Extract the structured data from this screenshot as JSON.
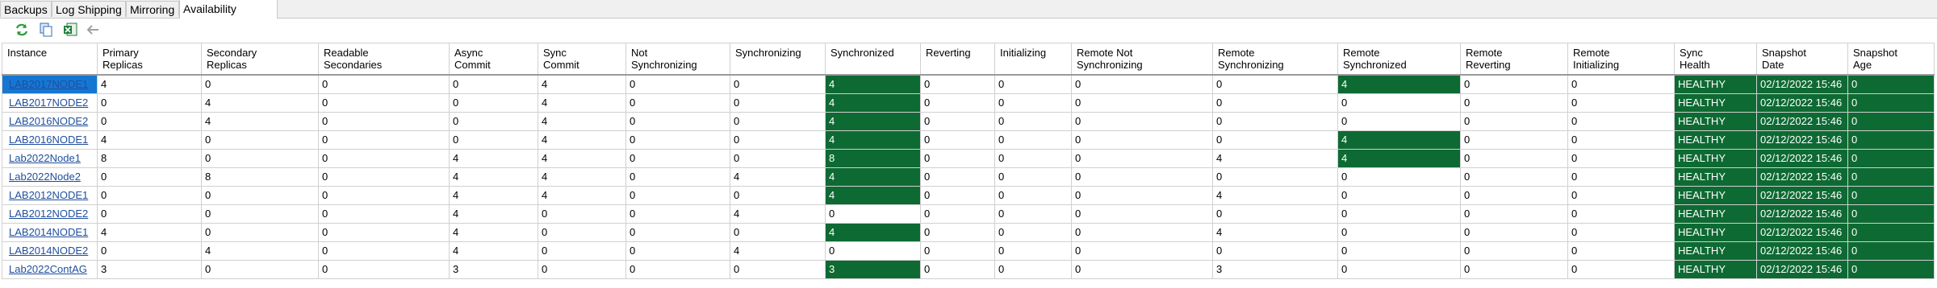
{
  "tabs": [
    {
      "label": "Backups",
      "active": false
    },
    {
      "label": "Log Shipping",
      "active": false
    },
    {
      "label": "Mirroring",
      "active": false
    },
    {
      "label": "Availability Groups",
      "active": true
    }
  ],
  "toolbar": [
    {
      "icon": "refresh-icon"
    },
    {
      "icon": "copy-icon"
    },
    {
      "icon": "export-excel-icon"
    },
    {
      "icon": "back-arrow-icon"
    }
  ],
  "colors": {
    "accent_green": "#0e6a33",
    "selection_blue": "#1677d3",
    "link": "#1f4e9e"
  },
  "grid": {
    "columns": [
      "Instance",
      "Primary\nReplicas",
      "Secondary\nReplicas",
      "Readable\nSecondaries",
      "Async\nCommit",
      "Sync\nCommit",
      "Not\nSynchronizing",
      "Synchronizing",
      "Synchronized",
      "Reverting",
      "Initializing",
      "Remote Not\nSynchronizing",
      "Remote\nSynchronizing",
      "Remote\nSynchronized",
      "Remote\nReverting",
      "Remote\nInitializing",
      "Sync\nHealth",
      "Snapshot\nDate",
      "Snapshot\nAge"
    ],
    "rows": [
      {
        "cells": [
          "LAB2017NODE1",
          "4",
          "0",
          "0",
          "0",
          "4",
          "0",
          "0",
          "4",
          "0",
          "0",
          "0",
          "0",
          "4",
          "0",
          "0",
          "HEALTHY",
          "02/12/2022 15:46",
          "0"
        ],
        "green": [
          8,
          13,
          16,
          17,
          18
        ],
        "selected": true
      },
      {
        "cells": [
          "LAB2017NODE2",
          "0",
          "4",
          "0",
          "0",
          "4",
          "0",
          "0",
          "4",
          "0",
          "0",
          "0",
          "0",
          "0",
          "0",
          "0",
          "HEALTHY",
          "02/12/2022 15:46",
          "0"
        ],
        "green": [
          8,
          16,
          17,
          18
        ],
        "selected": false
      },
      {
        "cells": [
          "LAB2016NODE2",
          "0",
          "4",
          "0",
          "0",
          "4",
          "0",
          "0",
          "4",
          "0",
          "0",
          "0",
          "0",
          "0",
          "0",
          "0",
          "HEALTHY",
          "02/12/2022 15:46",
          "0"
        ],
        "green": [
          8,
          16,
          17,
          18
        ],
        "selected": false
      },
      {
        "cells": [
          "LAB2016NODE1",
          "4",
          "0",
          "0",
          "0",
          "4",
          "0",
          "0",
          "4",
          "0",
          "0",
          "0",
          "0",
          "4",
          "0",
          "0",
          "HEALTHY",
          "02/12/2022 15:46",
          "0"
        ],
        "green": [
          8,
          13,
          16,
          17,
          18
        ],
        "selected": false
      },
      {
        "cells": [
          "Lab2022Node1",
          "8",
          "0",
          "0",
          "4",
          "4",
          "0",
          "0",
          "8",
          "0",
          "0",
          "0",
          "4",
          "4",
          "0",
          "0",
          "HEALTHY",
          "02/12/2022 15:46",
          "0"
        ],
        "green": [
          8,
          13,
          16,
          17,
          18
        ],
        "selected": false
      },
      {
        "cells": [
          "Lab2022Node2",
          "0",
          "8",
          "0",
          "4",
          "4",
          "0",
          "4",
          "4",
          "0",
          "0",
          "0",
          "0",
          "0",
          "0",
          "0",
          "HEALTHY",
          "02/12/2022 15:46",
          "0"
        ],
        "green": [
          8,
          16,
          17,
          18
        ],
        "selected": false
      },
      {
        "cells": [
          "LAB2012NODE1",
          "0",
          "0",
          "0",
          "4",
          "4",
          "0",
          "0",
          "4",
          "0",
          "0",
          "0",
          "4",
          "0",
          "0",
          "0",
          "HEALTHY",
          "02/12/2022 15:46",
          "0"
        ],
        "green": [
          8,
          16,
          17,
          18
        ],
        "selected": false
      },
      {
        "cells": [
          "LAB2012NODE2",
          "0",
          "0",
          "0",
          "4",
          "0",
          "0",
          "4",
          "0",
          "0",
          "0",
          "0",
          "0",
          "0",
          "0",
          "0",
          "HEALTHY",
          "02/12/2022 15:46",
          "0"
        ],
        "green": [
          16,
          17,
          18
        ],
        "selected": false
      },
      {
        "cells": [
          "LAB2014NODE1",
          "4",
          "0",
          "0",
          "4",
          "0",
          "0",
          "0",
          "4",
          "0",
          "0",
          "0",
          "4",
          "0",
          "0",
          "0",
          "HEALTHY",
          "02/12/2022 15:46",
          "0"
        ],
        "green": [
          8,
          16,
          17,
          18
        ],
        "selected": false
      },
      {
        "cells": [
          "LAB2014NODE2",
          "0",
          "4",
          "0",
          "4",
          "0",
          "0",
          "4",
          "0",
          "0",
          "0",
          "0",
          "0",
          "0",
          "0",
          "0",
          "HEALTHY",
          "02/12/2022 15:46",
          "0"
        ],
        "green": [
          16,
          17,
          18
        ],
        "selected": false
      },
      {
        "cells": [
          "Lab2022ContAG",
          "3",
          "0",
          "0",
          "3",
          "0",
          "0",
          "0",
          "3",
          "0",
          "0",
          "0",
          "3",
          "0",
          "0",
          "0",
          "HEALTHY",
          "02/12/2022 15:46",
          "0"
        ],
        "green": [
          8,
          16,
          17,
          18
        ],
        "selected": false
      }
    ]
  }
}
